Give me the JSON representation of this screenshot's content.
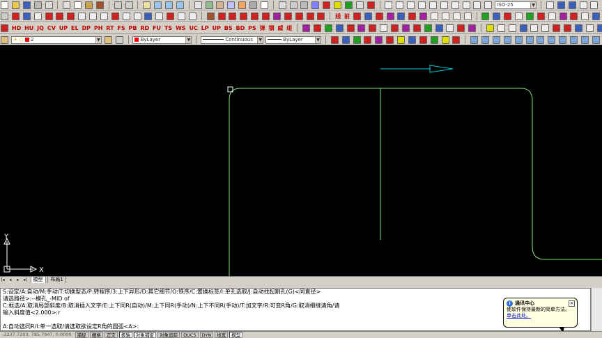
{
  "toolbar": {
    "dimstyle_value": "ISO-25",
    "layer_value": "2",
    "color_value": "ByLayer",
    "linetype_value": "Continuous",
    "lineweight_value": "ByLayer",
    "custom_labels_row3": [
      "HD",
      "HU",
      "JQ",
      "CV",
      "UP",
      "EL",
      "DP",
      "PH",
      "RT",
      "FS",
      "PB",
      "RD",
      "FU",
      "TS",
      "WS",
      "UC",
      "LP",
      "UP",
      "BS",
      "BD",
      "PS",
      "弹",
      "钢",
      "威",
      "组"
    ],
    "custom_labels_row2": [
      "线",
      "前"
    ]
  },
  "drawing": {
    "ucs_x_label": "X",
    "ucs_y_label": "Y"
  },
  "tabs": {
    "model": "模型",
    "layout1": "布局1"
  },
  "command": {
    "lines": [
      "S:设定/A:自动/M:手动/T:切换型态/P:转程序/3:上下异形/D:其它细节/O:铁序/C:置换标签/I:单孔选取/J:自动找起割孔(G)<同直径>",
      "请选路径>:--模孔_-MID of",
      "C:框选/A:取消局部斜度/B:取消插入文字/E:上下同R(自动)/M:上下同R(手动)/N:上下不同R(手动)/T:加文字/R:可变R角/G:取消细缝清角/请",
      "输入斜度值<2.000>:r",
      "",
      "A:自动选同R/I:单一选取/请选取欲设定R角的圆弧<A>:"
    ]
  },
  "status": {
    "coords": "-2237.7203, 785.7947, 0.0000",
    "buttons": [
      "捕捉",
      "栅格",
      "正交",
      "极轴",
      "对象捕捉",
      "对象追踪",
      "DUCS",
      "DYN",
      "线宽",
      "模型"
    ]
  },
  "bubble": {
    "title": "通讯中心",
    "body": "使软件保持最新的简单方法。",
    "link": "单击此处。"
  }
}
